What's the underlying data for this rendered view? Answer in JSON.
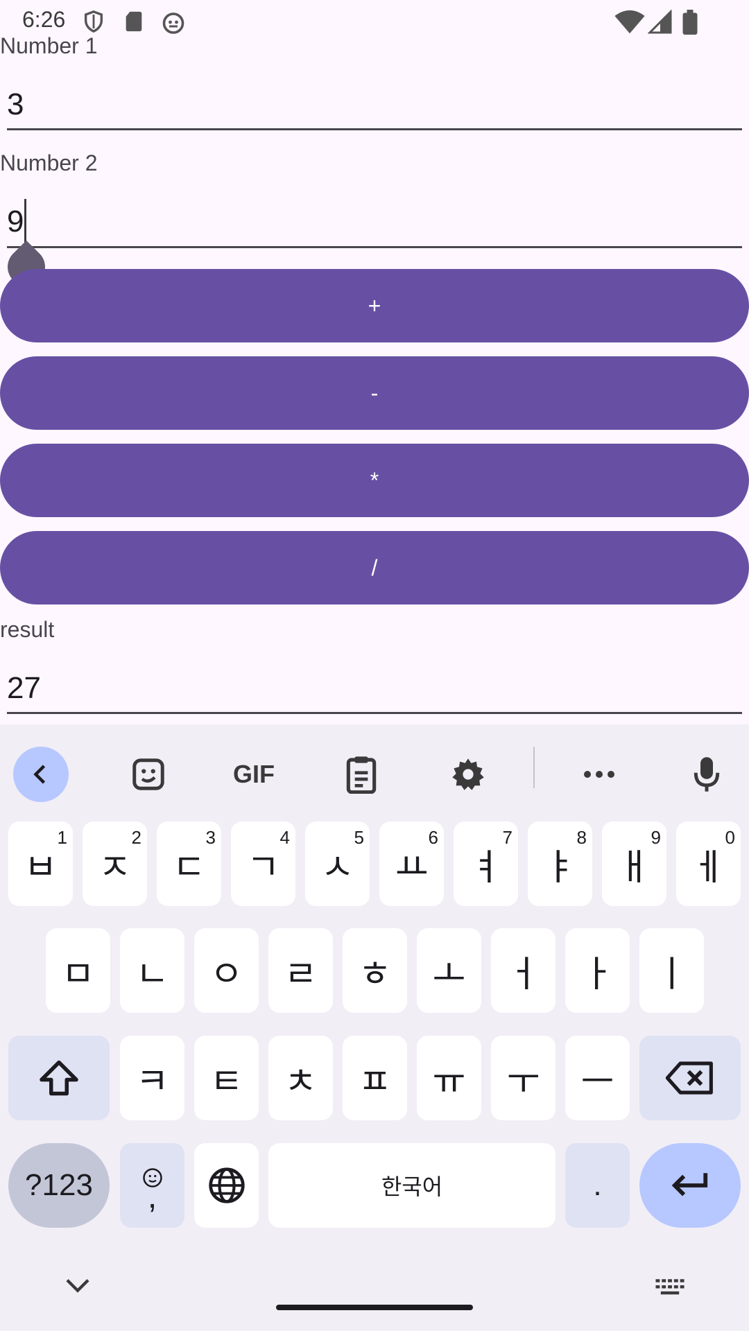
{
  "status_bar": {
    "time": "6:26",
    "icons_left": [
      "shield-icon",
      "sd-card-icon",
      "debug-icon"
    ],
    "icons_right": [
      "wifi-icon",
      "signal-icon",
      "battery-icon"
    ]
  },
  "form": {
    "number1": {
      "label": "Number 1",
      "value": "3"
    },
    "number2": {
      "label": "Number 2",
      "value": "9"
    },
    "buttons": {
      "add": "+",
      "subtract": "-",
      "multiply": "*",
      "divide": "/"
    },
    "result": {
      "label": "result",
      "value": "27"
    },
    "accent_color": "#6750a4"
  },
  "keyboard": {
    "toolbar": [
      "back-icon",
      "sticker-icon",
      "gif-icon",
      "clipboard-icon",
      "settings-icon",
      "more-icon",
      "mic-icon"
    ],
    "gif_label": "GIF",
    "row1": [
      {
        "k": "ㅂ",
        "n": "1"
      },
      {
        "k": "ㅈ",
        "n": "2"
      },
      {
        "k": "ㄷ",
        "n": "3"
      },
      {
        "k": "ㄱ",
        "n": "4"
      },
      {
        "k": "ㅅ",
        "n": "5"
      },
      {
        "k": "ㅛ",
        "n": "6"
      },
      {
        "k": "ㅕ",
        "n": "7"
      },
      {
        "k": "ㅑ",
        "n": "8"
      },
      {
        "k": "ㅐ",
        "n": "9"
      },
      {
        "k": "ㅔ",
        "n": "0"
      }
    ],
    "row2": [
      "ㅁ",
      "ㄴ",
      "ㅇ",
      "ㄹ",
      "ㅎ",
      "ㅗ",
      "ㅓ",
      "ㅏ",
      "ㅣ"
    ],
    "row3": [
      "ㅋ",
      "ㅌ",
      "ㅊ",
      "ㅍ",
      "ㅠ",
      "ㅜ",
      "ㅡ"
    ],
    "symbols_label": "?123",
    "comma_label": ",",
    "space_label": "한국어",
    "period_label": "."
  }
}
